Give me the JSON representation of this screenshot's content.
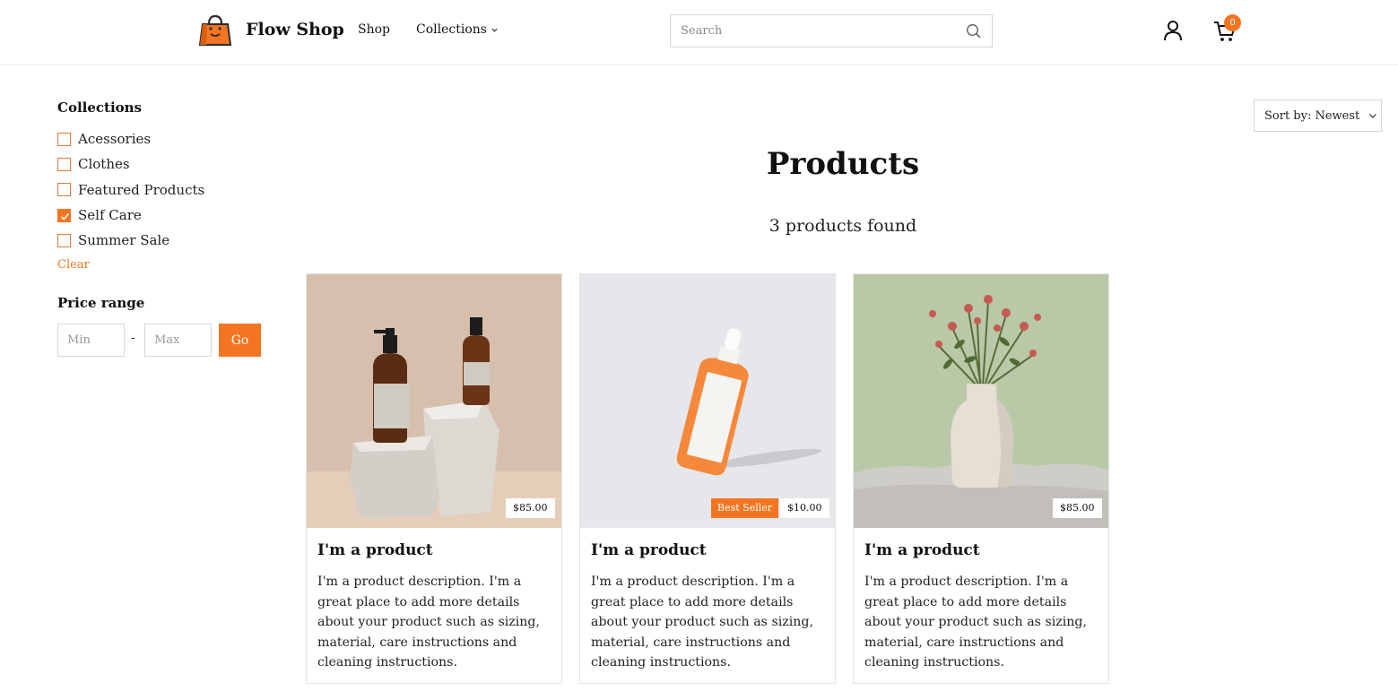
{
  "header": {
    "brand": "Flow Shop",
    "nav": {
      "shop": "Shop",
      "collections": "Collections"
    },
    "search": {
      "placeholder": "Search",
      "value": ""
    },
    "cart_count": "0"
  },
  "sidebar": {
    "collections_title": "Collections",
    "filters": [
      {
        "label": "Acessories",
        "checked": false
      },
      {
        "label": "Clothes",
        "checked": false
      },
      {
        "label": "Featured Products",
        "checked": false
      },
      {
        "label": "Self Care",
        "checked": true
      },
      {
        "label": "Summer Sale",
        "checked": false
      }
    ],
    "clear_label": "Clear",
    "price_title": "Price range",
    "min_placeholder": "Min",
    "max_placeholder": "Max",
    "dash": "-",
    "go_label": "Go"
  },
  "sort": {
    "label": "Sort by: Newest"
  },
  "main": {
    "title": "Products",
    "count": "3 products found"
  },
  "products": [
    {
      "title": "I'm a product",
      "price": "$85.00",
      "badge": "",
      "description": "I'm a product description. I'm a great place to add more details about your product such as sizing, material, care instructions and cleaning instructions."
    },
    {
      "title": "I'm a product",
      "price": "$10.00",
      "badge": "Best Seller",
      "description": "I'm a product description. I'm a great place to add more details about your product such as sizing, material, care instructions and cleaning instructions."
    },
    {
      "title": "I'm a product",
      "price": "$85.00",
      "badge": "",
      "description": "I'm a product description. I'm a great place to add more details about your product such as sizing, material, care instructions and cleaning instructions."
    }
  ],
  "colors": {
    "accent": "#f47521",
    "border": "#e3e3e3",
    "text": "#1a1a1a"
  },
  "icons": [
    "shopping-bag-logo-icon",
    "chevron-down-icon",
    "search-icon",
    "user-icon",
    "cart-icon",
    "checkmark-icon"
  ]
}
